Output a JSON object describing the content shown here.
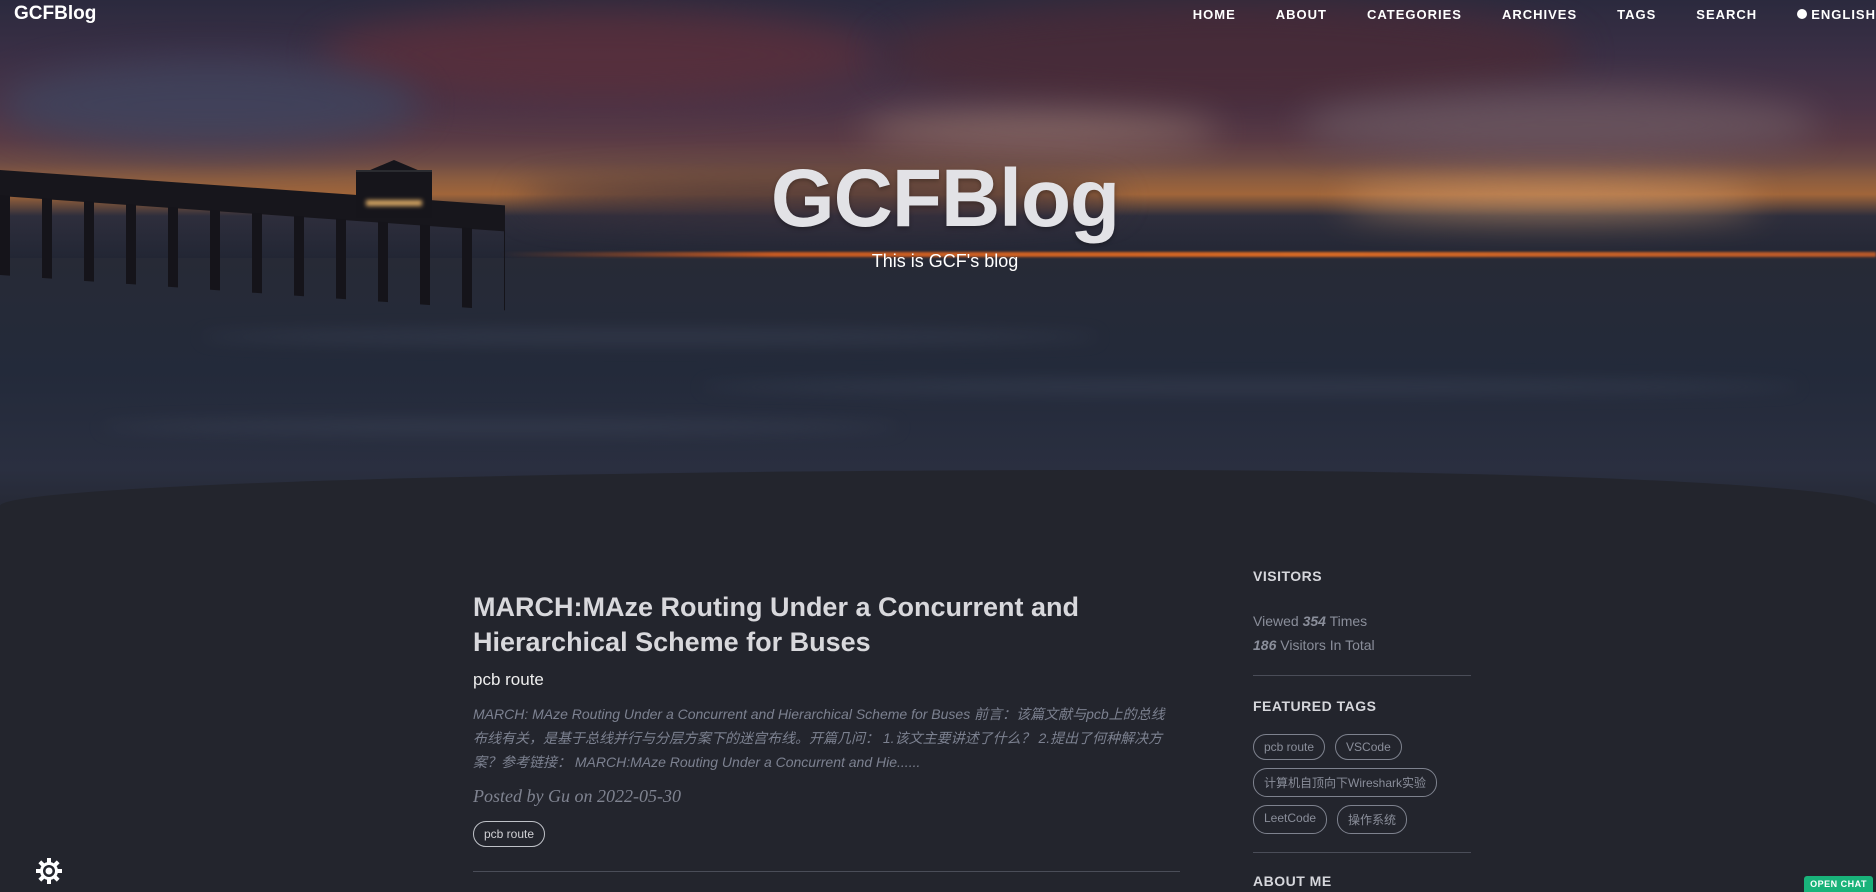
{
  "brand": "GCFBlog",
  "nav": {
    "items": [
      "HOME",
      "ABOUT",
      "CATEGORIES",
      "ARCHIVES",
      "TAGS",
      "SEARCH"
    ],
    "language": "ENGLISH"
  },
  "hero": {
    "title": "GCFBlog",
    "subtitle": "This is GCF's blog"
  },
  "post": {
    "title": "MARCH:MAze Routing Under a Concurrent and Hierarchical Scheme for Buses",
    "subtitle": "pcb route",
    "excerpt": "MARCH: MAze Routing Under a Concurrent and Hierarchical Scheme for Buses 前言：该篇文献与pcb上的总线布线有关，是基于总线并行与分层方案下的迷宫布线。开篇几问： 1.该文主要讲述了什么？ 2.提出了何种解决方案？参考链接： MARCH:MAze Routing Under a Concurrent and Hie......",
    "meta": "Posted by Gu on 2022-05-30",
    "tag": "pcb route"
  },
  "sidebar": {
    "visitors": {
      "heading": "VISITORS",
      "viewed_prefix": "Viewed",
      "viewed_count": "354",
      "viewed_suffix": "Times",
      "visitors_count": "186",
      "visitors_suffix": "Visitors In Total"
    },
    "featured_tags": {
      "heading": "FEATURED TAGS",
      "tags": [
        "pcb route",
        "VSCode",
        "计算机自顶向下Wireshark实验",
        "LeetCode",
        "操作系统"
      ]
    },
    "about_heading": "ABOUT ME"
  },
  "chat_button": "OPEN CHAT",
  "icons": {
    "language": "globe-icon",
    "theme": "sun-icon"
  }
}
